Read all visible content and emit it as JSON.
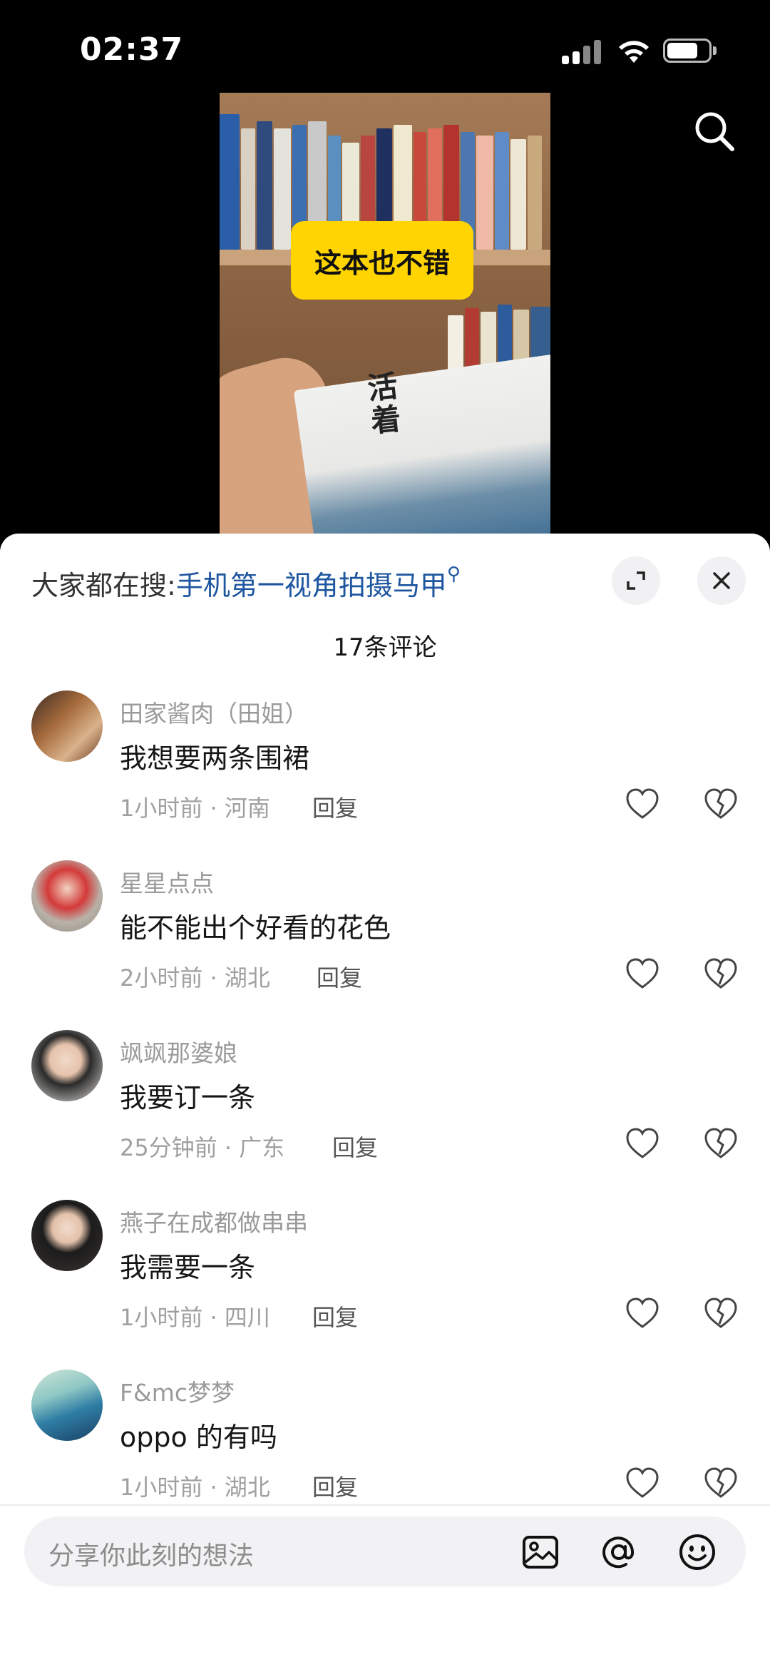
{
  "status_bar": {
    "time": "02:37"
  },
  "video": {
    "caption": "这本也不错",
    "book_title": "活着"
  },
  "comments_sheet": {
    "hot_search": {
      "prefix": "大家都在搜:",
      "query": "手机第一视角拍摄马甲",
      "icon": "search-small-icon"
    },
    "count_title": "17条评论",
    "comments": [
      {
        "user": "田家酱肉（田姐）",
        "text": "我想要两条围裙",
        "meta": "1小时前 · 河南",
        "reply": "回复"
      },
      {
        "user": "星星点点",
        "text": "能不能出个好看的花色",
        "meta": "2小时前 · 湖北",
        "reply": "回复"
      },
      {
        "user": "飒飒那婆娘",
        "text": "我要订一条",
        "meta": "25分钟前 · 广东",
        "reply": "回复"
      },
      {
        "user": "燕子在成都做串串",
        "text": "我需要一条",
        "meta": "1小时前 · 四川",
        "reply": "回复"
      },
      {
        "user": "F&mc梦梦",
        "text": "oppo 的有吗",
        "meta": "1小时前 · 湖北",
        "reply": "回复"
      }
    ],
    "input": {
      "placeholder": "分享你此刻的想法"
    }
  },
  "icons": [
    "signal-icon",
    "wifi-icon",
    "battery-icon",
    "search-icon",
    "expand-icon",
    "close-icon",
    "heart-icon",
    "broken-heart-icon",
    "image-icon",
    "at-icon",
    "emoji-icon"
  ],
  "colors": {
    "accent_link": "#1e56a0",
    "caption_bg": "#ffd400"
  }
}
